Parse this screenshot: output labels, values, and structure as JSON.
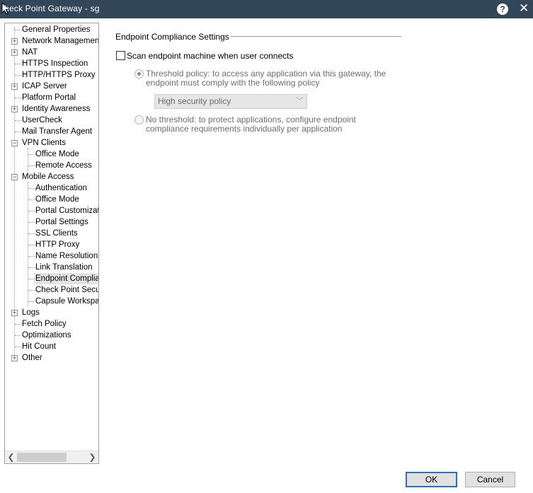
{
  "window": {
    "title": "heck Point Gateway - sg",
    "help_glyph": "?",
    "close_glyph": "✕"
  },
  "tree": {
    "items": [
      {
        "label": "General Properties"
      },
      {
        "label": "Network Management"
      },
      {
        "label": "NAT"
      },
      {
        "label": "HTTPS Inspection"
      },
      {
        "label": "HTTP/HTTPS Proxy"
      },
      {
        "label": "ICAP Server"
      },
      {
        "label": "Platform Portal"
      },
      {
        "label": "Identity Awareness"
      },
      {
        "label": "UserCheck"
      },
      {
        "label": "Mail Transfer Agent"
      },
      {
        "label": "VPN Clients"
      },
      {
        "label": "Office Mode"
      },
      {
        "label": "Remote Access"
      },
      {
        "label": "Mobile Access"
      },
      {
        "label": "Authentication"
      },
      {
        "label": "Office Mode"
      },
      {
        "label": "Portal Customizatio"
      },
      {
        "label": "Portal Settings"
      },
      {
        "label": "SSL Clients"
      },
      {
        "label": "HTTP Proxy"
      },
      {
        "label": "Name Resolution"
      },
      {
        "label": "Link Translation"
      },
      {
        "label": "Endpoint Complian"
      },
      {
        "label": "Check Point Secur"
      },
      {
        "label": "Capsule Workspac"
      },
      {
        "label": "Logs"
      },
      {
        "label": "Fetch Policy"
      },
      {
        "label": "Optimizations"
      },
      {
        "label": "Hit Count"
      },
      {
        "label": "Other"
      }
    ],
    "selected_index": 22,
    "expander_plus": "+",
    "expander_minus": "−"
  },
  "scrollbar": {
    "left_arrow": "❮",
    "right_arrow": "❯"
  },
  "content": {
    "section_title": "Endpoint Compliance Settings",
    "scan_checkbox_label": "Scan endpoint machine when user connects",
    "scan_checked": false,
    "threshold_label": "Threshold policy: to access any application via this gateway, the endpoint must comply with the following policy",
    "threshold_selected": true,
    "policy_select_value": "High security policy",
    "no_threshold_label": "No threshold: to protect applications, configure endpoint compliance requirements individually per application",
    "no_threshold_selected": false
  },
  "buttons": {
    "ok": "OK",
    "cancel": "Cancel"
  }
}
